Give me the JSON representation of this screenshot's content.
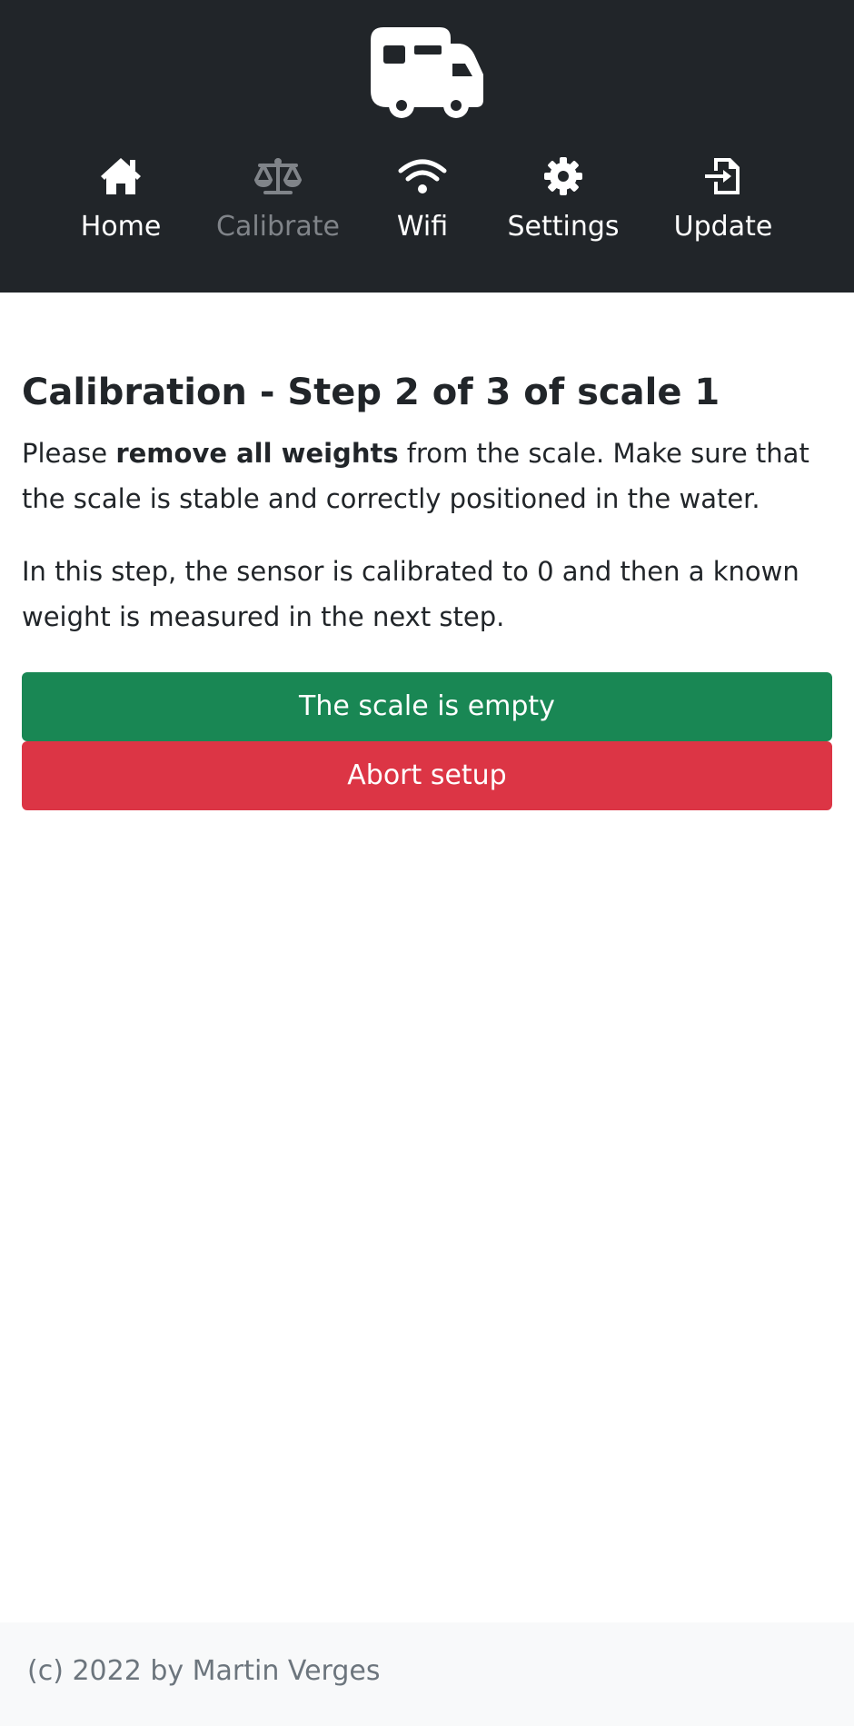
{
  "header": {
    "logo_icon": "rv-camper-icon"
  },
  "nav": {
    "items": [
      {
        "label": "Home",
        "icon": "home-icon",
        "active": false
      },
      {
        "label": "Calibrate",
        "icon": "scale-balance-icon",
        "active": true
      },
      {
        "label": "Wifi",
        "icon": "wifi-icon",
        "active": false
      },
      {
        "label": "Settings",
        "icon": "gear-icon",
        "active": false
      },
      {
        "label": "Update",
        "icon": "file-import-icon",
        "active": false
      }
    ]
  },
  "main": {
    "title": "Calibration - Step 2 of 3 of scale 1",
    "instruction": {
      "prefix": "Please ",
      "emphasis": "remove all weights",
      "suffix": " from the scale. Make sure that the scale is stable and correctly positioned in the water."
    },
    "note": "In this step, the sensor is calibrated to 0 and then a known weight is measured in the next step.",
    "confirm_button": "The scale is empty",
    "abort_button": "Abort setup"
  },
  "footer": {
    "text": "(c) 2022 by Martin Verges"
  },
  "colors": {
    "header_bg": "#212529",
    "nav_active": "#808489",
    "success": "#198754",
    "danger": "#dc3545",
    "footer_bg": "#f8f9fa",
    "footer_text": "#6c757d"
  }
}
